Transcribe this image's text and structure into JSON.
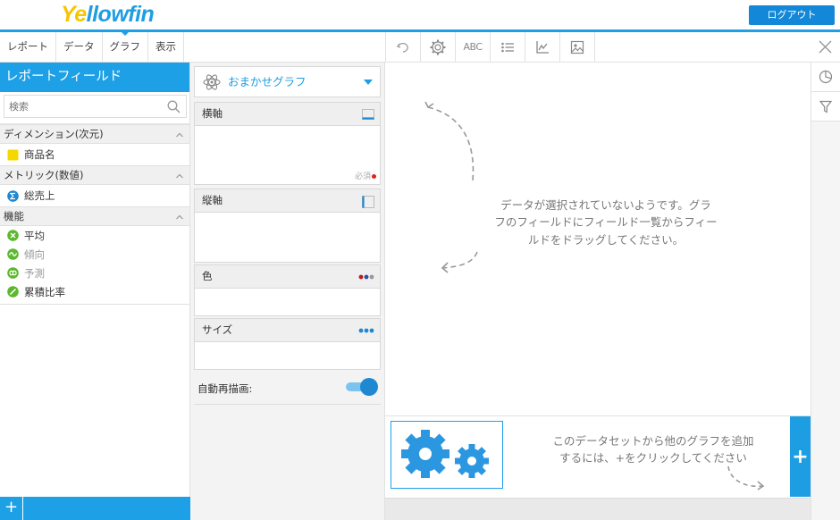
{
  "header": {
    "logo_part1": "Ye",
    "logo_part2": "llowfin",
    "logout_label": "ログアウト"
  },
  "nav_tabs": [
    {
      "label": "レポート"
    },
    {
      "label": "データ"
    },
    {
      "label": "グラフ"
    },
    {
      "label": "表示"
    }
  ],
  "toolbar": {
    "icons": [
      "undo-icon",
      "gear-icon",
      "abc-text-icon",
      "list-icon",
      "axis-chart-icon",
      "image-icon",
      "close-icon"
    ],
    "abc_label": "ABC"
  },
  "left_panel": {
    "title": "レポートフィールド",
    "search_placeholder": "検索",
    "sections": [
      {
        "label": "ディメンション(次元)",
        "items": [
          {
            "label": "商品名",
            "icon": "dimension-square-icon"
          }
        ]
      },
      {
        "label": "メトリック(数値)",
        "items": [
          {
            "label": "総売上",
            "icon": "sigma-icon"
          }
        ]
      },
      {
        "label": "機能",
        "items": [
          {
            "label": "平均",
            "icon": "average-icon"
          },
          {
            "label": "傾向",
            "icon": "trend-icon"
          },
          {
            "label": "予測",
            "icon": "forecast-icon"
          },
          {
            "label": "累積比率",
            "icon": "cumulative-icon"
          }
        ]
      }
    ],
    "add_label": "+"
  },
  "middle_panel": {
    "graph_type": "おまかせグラフ",
    "boxes": [
      {
        "label": "横軸",
        "required": "必須"
      },
      {
        "label": "縦軸"
      },
      {
        "label": "色"
      },
      {
        "label": "サイズ"
      }
    ],
    "auto_redraw_label": "自動再描画:",
    "auto_redraw_on": true
  },
  "canvas": {
    "empty_lines": [
      "データが選択されていないようです。グラ",
      "フのフィールドにフィールド一覧からフィー",
      "ルドをドラッグしてください。"
    ]
  },
  "dataset": {
    "msg_lines": [
      "このデータセットから他のグラフを追加",
      "するには、+をクリックしてください"
    ],
    "add_label": "+"
  },
  "colors": {
    "accent": "#1ea0e6",
    "logo_yellow": "#f7c500",
    "dimension_yellow": "#f5d800",
    "function_green": "#5cb82e",
    "sigma_blue": "#1e88d0",
    "required_red": "#e02020"
  }
}
